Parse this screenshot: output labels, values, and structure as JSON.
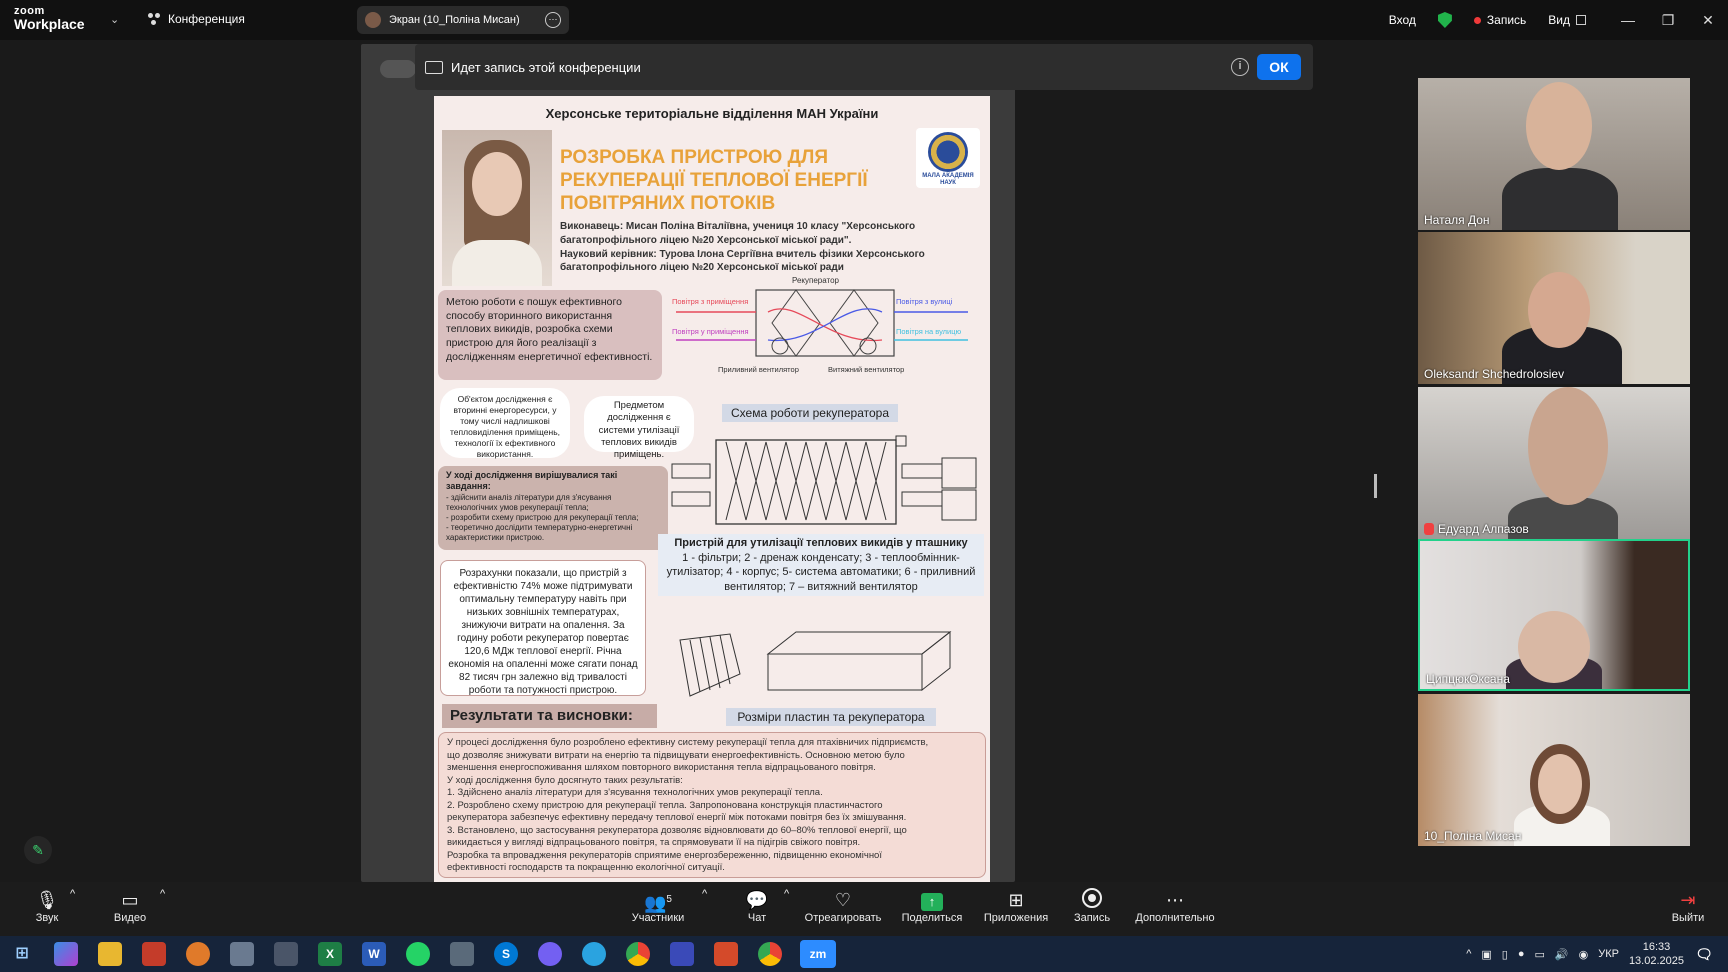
{
  "app": {
    "logo_line1": "zoom",
    "logo_line2": "Workplace",
    "conference_label": "Конференция",
    "screen_tab_label": "Экран (10_Поліна Мисан)",
    "signin_label": "Вход",
    "record_label": "Запись",
    "view_label": "Вид",
    "accent_color": "#0e72ed"
  },
  "notice": {
    "text": "Идет запись этой конференции",
    "ok_label": "ОК"
  },
  "poster": {
    "header": "Херсонське територіальне відділення МАН України",
    "title": "РОЗРОБКА ПРИСТРОЮ ДЛЯ РЕКУПЕРАЦІЇ ТЕПЛОВОЇ ЕНЕРГІЇ ПОВІТРЯНИХ ПОТОКІВ",
    "logo_text": "МАЛА АКАДЕМІЯ НАУК",
    "authors_line1": "Виконавець: Мисан Поліна Віталіївна, учениця 10 класу \"Херсонського багатопрофільного ліцею №20 Херсонської міської ради\".",
    "authors_line2": "Науковий керівник: Турова Ілона Сергіївна вчитель фізики Херсонського багатопрофільного ліцею №20 Херсонської міської ради",
    "goal": "Метою роботи є пошук ефективного способу вторинного використання теплових викидів, розробка схеми пристрою для його реалізації з дослідженням енергетичної ефективності.",
    "object": "Об'єктом дослідження є вторинні енергоресурси, у тому числі надлишкові тепловиділення приміщень, технології їх ефективного використання.",
    "subject": "Предметом дослідження є системи утилізації теплових викидів приміщень.",
    "tasks_title": "У ході дослідження вирішувалися такі завдання:",
    "tasks": [
      "- здійснити аналіз літератури для з'ясування технологічних умов рекуперації тепла;",
      "- розробити схему пристрою для рекуперації тепла;",
      "- теоретично дослідити температурно-енергетичні характеристики пристрою."
    ],
    "results": "Розрахунки показали, що пристрій з ефективністю 74% може підтримувати оптимальну температуру навіть при низьких зовнішніх температурах, знижуючи витрати на опалення. За годину роботи рекуператор повертає 120,6 МДж теплової енергії. Річна економія на опаленні може сягати понад 82 тисяч грн залежно від тривалості роботи та потужності пристрою.",
    "diagram1": {
      "recuperator": "Рекуператор",
      "air_from_room": "Повітря з приміщення",
      "air_from_street": "Повітря з вулиці",
      "air_to_room": "Повітря у приміщення",
      "air_to_street": "Повітря на вулицю",
      "supply_fan": "Приливний вентилятор",
      "exhaust_fan": "Витяжний вентилятор",
      "caption": "Схема роботи рекуператора"
    },
    "device_title": "Пристрій для утилізації теплових викидів у пташнику",
    "device_desc": "1 - фільтри; 2 - дренаж конденсату; 3 - теплообмінник-утилізатор; 4 - корпус; 5- система автоматики; 6 - приливний вентилятор; 7 – витяжний вентилятор",
    "plates_caption": "Розміри пластин та рекуператора",
    "conclusions_title": "Результати та висновки:",
    "conclusions": [
      "У процесі дослідження було розроблено ефективну систему рекуперації тепла для птахівничих підприємств,",
      "що дозволяє знижувати витрати на енергію та підвищувати енергоефективність. Основною метою було",
      "зменшення енергоспоживання шляхом повторного використання тепла відпрацьованого повітря.",
      "У ході дослідження було досягнуто таких результатів:",
      "   1. Здійснено аналіз літератури для з'ясування технологічних умов рекуперації тепла.",
      "   2. Розроблено схему пристрою для рекуперації тепла. Запропонована конструкція пластинчастого",
      "       рекуператора забезпечує ефективну передачу теплової енергії між потоками повітря без їх змішування.",
      "   3. Встановлено, що застосування рекуператора дозволяє відновлювати до 60–80% теплової енергії, що",
      "       викидається у вигляді відпрацьованого повітря, та спрямовувати її на підігрів свіжого повітря.",
      "Розробка та впровадження рекуператорів сприятиме енергозбереженню, підвищенню економічної",
      "ефективності господарств та покращенню екологічної ситуації."
    ]
  },
  "participants": [
    {
      "name": "Наталя Дон",
      "muted": false,
      "active": false
    },
    {
      "name": "Oleksandr Shchedrolosiev",
      "muted": false,
      "active": false
    },
    {
      "name": "Едуард Алпазов",
      "muted": true,
      "active": false
    },
    {
      "name": "ЦипцюкОксана",
      "muted": false,
      "active": true
    },
    {
      "name": "10_Поліна Мисан",
      "muted": false,
      "active": false
    }
  ],
  "toolbar": {
    "audio": "Звук",
    "video": "Видео",
    "participants": "Участники",
    "participants_count": "5",
    "chat": "Чат",
    "react": "Отреагировать",
    "share": "Поделиться",
    "apps": "Приложения",
    "record": "Запись",
    "more": "Дополнительно",
    "leave": "Выйти"
  },
  "taskbar": {
    "lang": "УКР",
    "time": "16:33",
    "date": "13.02.2025",
    "zoom_label": "zm"
  }
}
